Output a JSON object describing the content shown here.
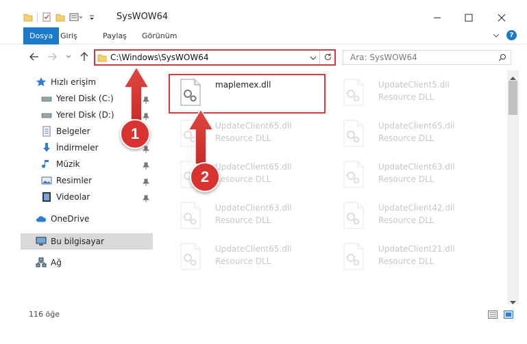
{
  "window": {
    "title": "SysWOW64",
    "minimize_icon": "minimize-icon",
    "maximize_icon": "maximize-icon",
    "close_icon": "close-icon"
  },
  "ribbon": {
    "tabs": [
      "Dosya",
      "Giriş",
      "Paylaş",
      "Görünüm"
    ]
  },
  "address": {
    "path": "C:\\Windows\\SysWOW64",
    "search_placeholder": "Ara: SysWOW64"
  },
  "nav": {
    "quick_access": "Hızlı erişim",
    "items": [
      {
        "label": "Yerel Disk (C:)",
        "icon": "drive-icon",
        "pinned": true
      },
      {
        "label": "Yerel Disk (D:)",
        "icon": "drive-icon",
        "pinned": true
      },
      {
        "label": "Belgeler",
        "icon": "documents-icon",
        "pinned": true
      },
      {
        "label": "İndirmeler",
        "icon": "downloads-icon",
        "pinned": true
      },
      {
        "label": "Müzik",
        "icon": "music-icon",
        "pinned": true
      },
      {
        "label": "Resimler",
        "icon": "pictures-icon",
        "pinned": true
      },
      {
        "label": "Videolar",
        "icon": "videos-icon",
        "pinned": true
      }
    ],
    "onedrive": "OneDrive",
    "this_pc": "Bu bilgisayar",
    "network": "Ağ"
  },
  "files": [
    {
      "name": "maplemex.dll",
      "type": "",
      "faded": false
    },
    {
      "name": "UpdateClient5.dll",
      "type": "Resource DLL",
      "faded": true
    },
    {
      "name": "UpdateClient65.dll",
      "type": "Resource DLL",
      "faded": true
    },
    {
      "name": "UpdateClient65.dll",
      "type": "Resource DLL",
      "faded": true
    },
    {
      "name": "UpdateClient65.dll",
      "type": "Resource DLL",
      "faded": true
    },
    {
      "name": "UpdateClient63.dll",
      "type": "Resource DLL",
      "faded": true
    },
    {
      "name": "UpdateClient63.dll",
      "type": "Resource DLL",
      "faded": true
    },
    {
      "name": "UpdateClient42.dll",
      "type": "Resource DLL",
      "faded": true
    },
    {
      "name": "UpdateClient65.dll",
      "type": "Resource DLL",
      "faded": true
    },
    {
      "name": "UpdateClient21.dll",
      "type": "Resource DLL",
      "faded": true
    }
  ],
  "status": {
    "count": "116 öğe"
  },
  "callouts": [
    "1",
    "2"
  ],
  "colors": {
    "accent": "#1979ca",
    "highlight": "#d23a3a",
    "callout": "#d9332f"
  }
}
